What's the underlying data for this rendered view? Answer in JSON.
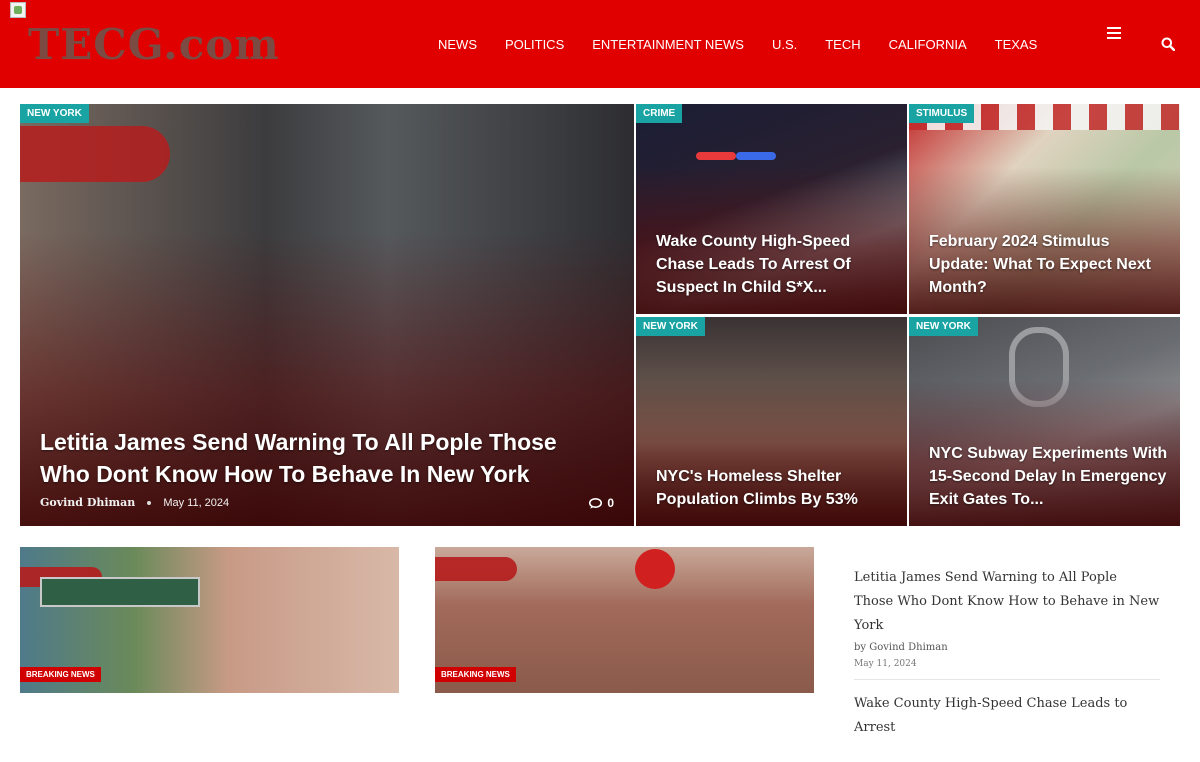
{
  "site": {
    "logo_text": "TECG.com"
  },
  "nav": {
    "items": [
      "NEWS",
      "POLITICS",
      "ENTERTAINMENT NEWS",
      "U.S.",
      "TECH",
      "CALIFORNIA",
      "TEXAS"
    ]
  },
  "icons": {
    "menu": "hamburger-icon",
    "search": "search-icon",
    "comments": "comment-icon"
  },
  "colors": {
    "header": "#e10000",
    "category_badge": "#19a3a3",
    "breaking_badge": "#d10000"
  },
  "featured": {
    "main": {
      "category": "NEW YORK",
      "title": "Letitia James Send Warning To All Pople Those Who Dont Know How To Behave In New York",
      "author": "Govind Dhiman",
      "date": "May 11, 2024",
      "comments": "0"
    },
    "tiles": [
      {
        "category": "CRIME",
        "title": "Wake County High-Speed Chase Leads To Arrest Of Suspect In Child S*X..."
      },
      {
        "category": "STIMULUS",
        "title": "February 2024 Stimulus Update: What To Expect Next Month?"
      },
      {
        "category": "NEW YORK",
        "title": "NYC's Homeless Shelter Population Climbs By 53%"
      },
      {
        "category": "NEW YORK",
        "title": "NYC Subway Experiments With 15-Second Delay In Emergency Exit Gates To..."
      }
    ]
  },
  "cards": [
    {
      "badge": "BREAKING NEWS"
    },
    {
      "badge": "BREAKING NEWS"
    }
  ],
  "sidebar_list": [
    {
      "title": "Letitia James Send Warning to All Pople Those Who Dont Know How to Behave in New York",
      "by": "by Govind Dhiman",
      "date": "May 11, 2024"
    },
    {
      "title": "Wake County High-Speed Chase Leads to Arrest"
    }
  ]
}
